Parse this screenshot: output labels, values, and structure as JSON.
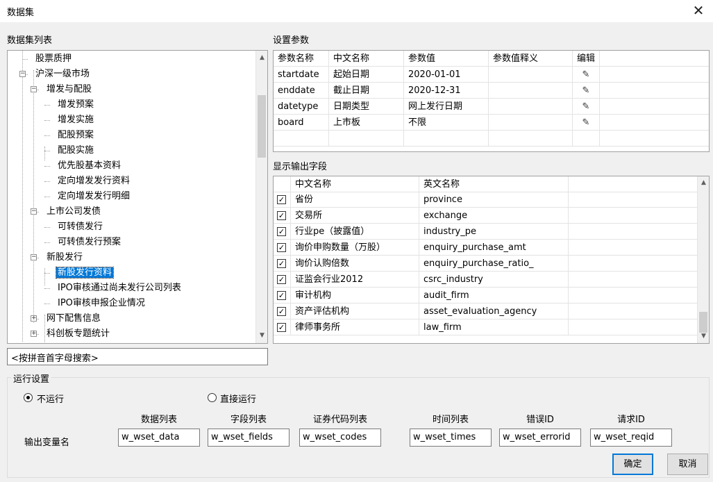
{
  "window": {
    "title": "数据集",
    "close_glyph": "✕"
  },
  "tree": {
    "label": "数据集列表",
    "items": [
      {
        "text": "股票质押",
        "level": 1,
        "expander": ""
      },
      {
        "text": "沪深一级市场",
        "level": 1,
        "expander": "−"
      },
      {
        "text": "增发与配股",
        "level": 2,
        "expander": "−"
      },
      {
        "text": "增发预案",
        "level": 3,
        "expander": ""
      },
      {
        "text": "增发实施",
        "level": 3,
        "expander": ""
      },
      {
        "text": "配股预案",
        "level": 3,
        "expander": ""
      },
      {
        "text": "配股实施",
        "level": 3,
        "expander": ""
      },
      {
        "text": "优先股基本资料",
        "level": 3,
        "expander": ""
      },
      {
        "text": "定向增发发行资料",
        "level": 3,
        "expander": ""
      },
      {
        "text": "定向增发发行明细",
        "level": 3,
        "expander": ""
      },
      {
        "text": "上市公司发债",
        "level": 2,
        "expander": "−"
      },
      {
        "text": "可转债发行",
        "level": 3,
        "expander": ""
      },
      {
        "text": "可转债发行预案",
        "level": 3,
        "expander": ""
      },
      {
        "text": "新股发行",
        "level": 2,
        "expander": "−"
      },
      {
        "text": "新股发行资料",
        "level": 3,
        "expander": "",
        "selected": true
      },
      {
        "text": "IPO审核通过尚未发行公司列表",
        "level": 3,
        "expander": ""
      },
      {
        "text": "IPO审核申报企业情况",
        "level": 3,
        "expander": ""
      },
      {
        "text": "网下配售信息",
        "level": 2,
        "expander": "+"
      },
      {
        "text": "科创板专题统计",
        "level": 2,
        "expander": "+"
      }
    ],
    "search_placeholder": "<按拼音首字母搜索>"
  },
  "params": {
    "label": "设置参数",
    "headers": [
      "参数名称",
      "中文名称",
      "参数值",
      "参数值释义",
      "编辑"
    ],
    "rows": [
      [
        "startdate",
        "起始日期",
        "2020-01-01",
        ""
      ],
      [
        "enddate",
        "截止日期",
        "2020-12-31",
        ""
      ],
      [
        "datetype",
        "日期类型",
        "网上发行日期",
        ""
      ],
      [
        "board",
        "上市板",
        "不限",
        ""
      ]
    ],
    "edit_icon": "✎"
  },
  "fields": {
    "label": "显示输出字段",
    "headers": [
      "中文名称",
      "英文名称"
    ],
    "check_glyph": "✓",
    "rows": [
      [
        "省份",
        "province"
      ],
      [
        "交易所",
        "exchange"
      ],
      [
        "行业pe（披露值）",
        "industry_pe"
      ],
      [
        "询价申购数量（万股）",
        "enquiry_purchase_amt"
      ],
      [
        "询价认购倍数",
        "enquiry_purchase_ratio_"
      ],
      [
        "证监会行业2012",
        "csrc_industry"
      ],
      [
        "审计机构",
        "audit_firm"
      ],
      [
        "资产评估机构",
        "asset_evaluation_agency"
      ],
      [
        "律师事务所",
        "law_firm"
      ]
    ]
  },
  "run": {
    "label": "运行设置",
    "option_no_run": "不运行",
    "option_run": "直接运行",
    "output_label": "输出变量名",
    "vars": [
      {
        "label": "数据列表",
        "value": "w_wset_data"
      },
      {
        "label": "字段列表",
        "value": "w_wset_fields"
      },
      {
        "label": "证券代码列表",
        "value": "w_wset_codes"
      },
      {
        "label": "时间列表",
        "value": "w_wset_times"
      },
      {
        "label": "错误ID",
        "value": "w_wset_errorid"
      },
      {
        "label": "请求ID",
        "value": "w_wset_reqid"
      }
    ],
    "ok_label": "确定",
    "cancel_label": "取消"
  }
}
